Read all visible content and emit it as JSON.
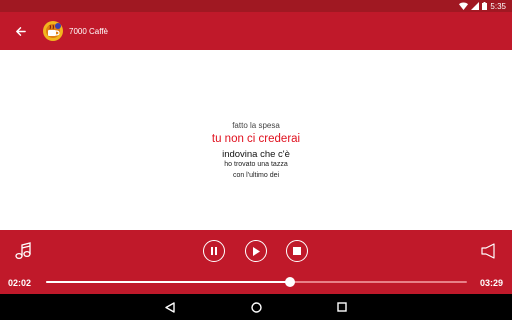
{
  "status_bar": {
    "time": "5:35"
  },
  "app_bar": {
    "title": "7000 Caffè"
  },
  "lyrics": {
    "lines": [
      "fatto la spesa",
      "tu non ci crederai",
      "indovina che c'è",
      "ho trovato una tazza",
      "con l'ultimo dei"
    ],
    "current_index": 1
  },
  "player": {
    "elapsed": "02:02",
    "total": "03:29",
    "progress": 0.58
  },
  "colors": {
    "primary": "#c0192a",
    "status_bar": "#a01822",
    "highlight_text": "#e0101e"
  },
  "icons": {
    "back": "arrow-back-icon",
    "music": "music-note-icon",
    "pause": "pause-icon",
    "play": "play-icon",
    "stop": "stop-icon",
    "volume": "volume-icon"
  }
}
